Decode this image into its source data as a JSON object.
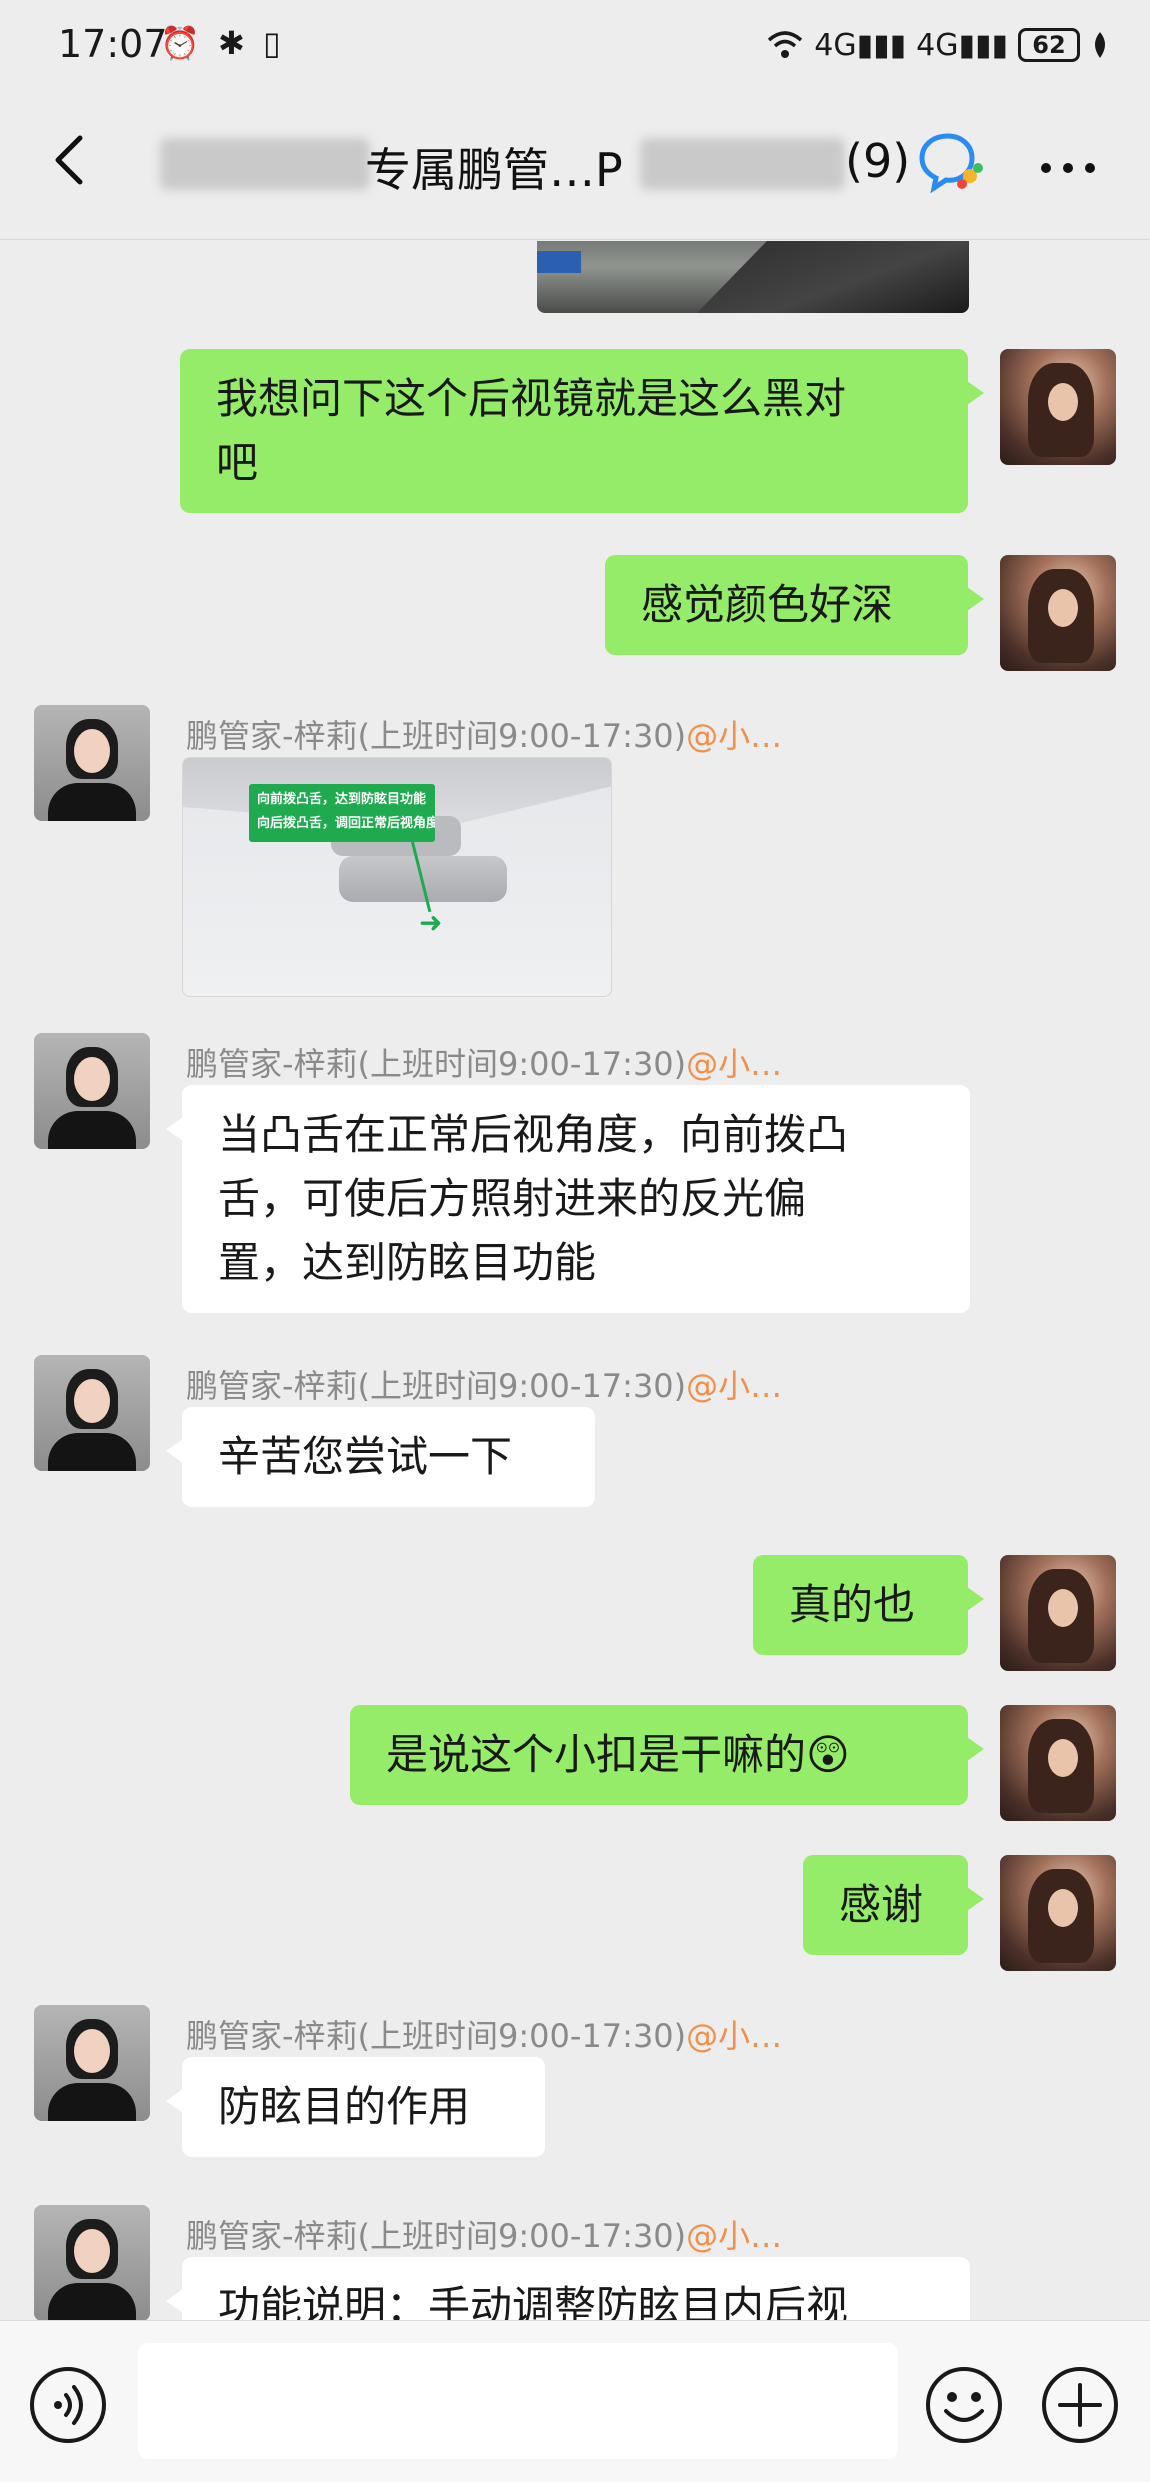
{
  "status_bar": {
    "time": "17:07",
    "left_icons": "⏰ ✱ ▯",
    "signal_1": "4G▮▮▮",
    "signal_2": "4G▮▮▮",
    "battery": "62"
  },
  "header": {
    "title": "专属鹏管…P",
    "member_count": "(9)"
  },
  "messages": [
    {
      "side": "self",
      "type": "image",
      "description_icon": "car-interior-photo"
    },
    {
      "side": "self",
      "type": "text",
      "text_line1": "我想问下这个后视镜就是这么黑对",
      "text_line2": "吧"
    },
    {
      "side": "self",
      "type": "text",
      "text": "感觉颜色好深"
    },
    {
      "side": "agent",
      "type": "image",
      "sender": "鹏管家-梓莉(上班时间9:00-17:30)",
      "mention": "@小…",
      "callout_line1": "向前拨凸舌，达到防眩目功能",
      "callout_line2": "向后拨凸舌，调回正常后视角度"
    },
    {
      "side": "agent",
      "type": "text",
      "sender": "鹏管家-梓莉(上班时间9:00-17:30)",
      "mention": "@小…",
      "text_line1": "当凸舌在正常后视角度，向前拨凸",
      "text_line2": "舌，可使后方照射进来的反光偏",
      "text_line3": "置，达到防眩目功能"
    },
    {
      "side": "agent",
      "type": "text",
      "sender": "鹏管家-梓莉(上班时间9:00-17:30)",
      "mention": "@小…",
      "text": "辛苦您尝试一下"
    },
    {
      "side": "self",
      "type": "text",
      "text": "真的也"
    },
    {
      "side": "self",
      "type": "text",
      "text": "是说这个小扣是干嘛的",
      "emoji": "😲"
    },
    {
      "side": "self",
      "type": "text",
      "text": "感谢"
    },
    {
      "side": "agent",
      "type": "text",
      "sender": "鹏管家-梓莉(上班时间9:00-17:30)",
      "mention": "@小…",
      "text": "防眩目的作用"
    },
    {
      "side": "agent",
      "type": "text",
      "sender": "鹏管家-梓莉(上班时间9:00-17:30)",
      "mention": "@小…",
      "text": "功能说明：手动调整防眩目内后视"
    }
  ],
  "input": {
    "placeholder": ""
  },
  "colors": {
    "self_bubble": "#95ec69",
    "agent_bubble": "#ffffff",
    "background": "#ededed",
    "mention": "#f0904a"
  }
}
